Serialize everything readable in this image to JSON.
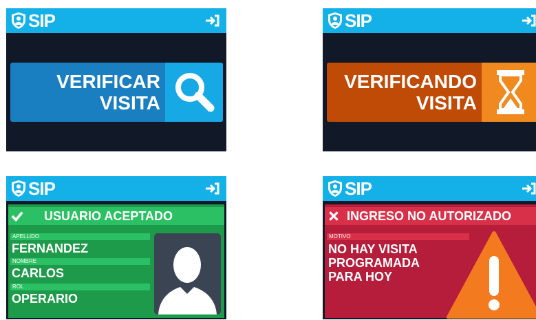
{
  "app": {
    "logo_text": "SIP"
  },
  "verify_screen": {
    "button_line1": "VERIFICAR",
    "button_line2": "VISITA",
    "icon": "search-icon"
  },
  "verifying_screen": {
    "button_line1": "VERIFICANDO",
    "button_line2": "VISITA",
    "icon": "hourglass-icon"
  },
  "accepted_screen": {
    "banner": "USUARIO ACEPTADO",
    "fields": [
      {
        "label": "APELLIDO",
        "value": "FERNANDEZ"
      },
      {
        "label": "NOMBRE",
        "value": "CARLOS"
      },
      {
        "label": "ROL",
        "value": "OPERARIO"
      }
    ],
    "icon": "checkmark-icon"
  },
  "denied_screen": {
    "banner": "INGRESO NO AUTORIZADO",
    "reason_label": "MOTIVO",
    "reason_lines": [
      "NO HAY VISITA",
      "PROGRAMADA",
      "PARA HOY"
    ],
    "icon": "close-icon"
  },
  "colors": {
    "header": "#14b1e8",
    "background": "#111827",
    "verify_button": "#1a7fc1",
    "verifying_button": "#c04b06",
    "accepted": "#1d9a4a",
    "denied": "#b51d3a"
  }
}
